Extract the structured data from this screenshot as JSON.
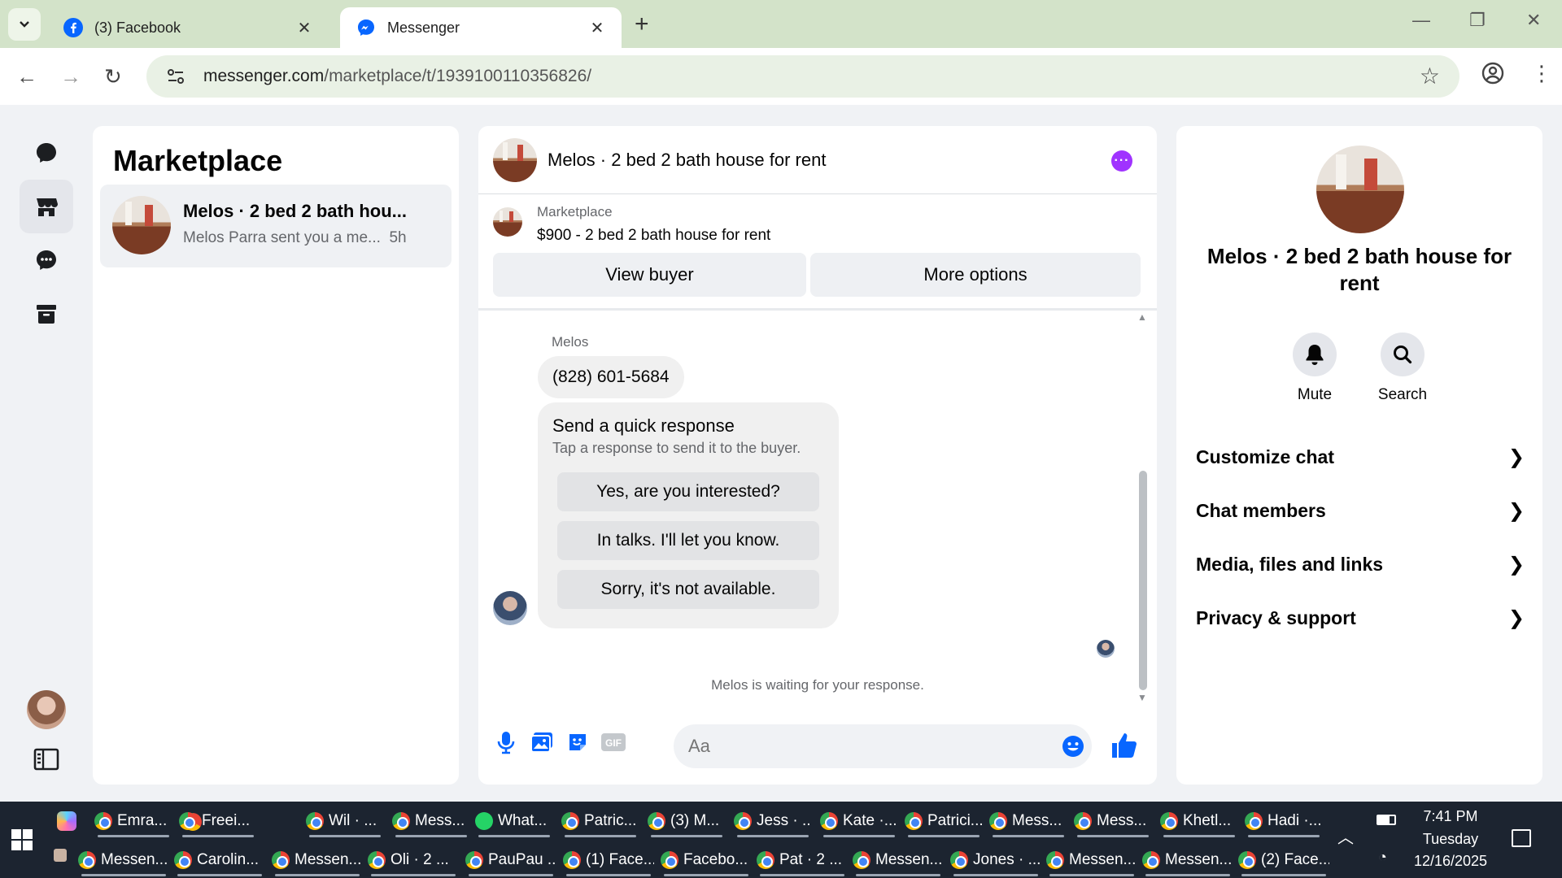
{
  "browser": {
    "tabs": [
      {
        "title": "(3) Facebook"
      },
      {
        "title": "Messenger"
      }
    ],
    "url_host": "messenger.com",
    "url_path": "/marketplace/t/1939100110356826/"
  },
  "left_panel": {
    "title": "Marketplace",
    "conversation": {
      "name": "Melos · 2 bed 2 bath hou...",
      "preview": "Melos Parra sent you a me...",
      "time": "5h"
    }
  },
  "chat": {
    "header_title": "Melos · 2 bed 2 bath house for rent",
    "listing_category": "Marketplace",
    "listing_title": "$900 - 2 bed 2 bath house for rent",
    "view_buyer_label": "View buyer",
    "more_options_label": "More options",
    "sender": "Melos",
    "phone_message": "(828) 601-5684",
    "quick_title": "Send a quick response",
    "quick_subtitle": "Tap a response to send it to the buyer.",
    "quick_responses": [
      "Yes, are you interested?",
      "In talks. I'll let you know.",
      "Sorry, it's not available."
    ],
    "waiting_text": "Melos is waiting for your response.",
    "composer_placeholder": "Aa",
    "gif_label": "GIF"
  },
  "info": {
    "title": "Melos · 2 bed 2 bath house for rent",
    "mute_label": "Mute",
    "search_label": "Search",
    "rows": [
      "Customize chat",
      "Chat members",
      "Media, files and links",
      "Privacy & support"
    ]
  },
  "taskbar": {
    "row1": [
      "Emra...",
      "Freei...",
      "Wil · ...",
      "Mess...",
      "What...",
      "Patric...",
      "(3) M...",
      "Jess · ...",
      "Kate ·...",
      "Patrici...",
      "Mess...",
      "Mess...",
      "Khetl...",
      "Hadi ·..."
    ],
    "row2": [
      "Messen...",
      "Carolin...",
      "Messen...",
      "Oli · 2 ...",
      "PauPau ...",
      "(1) Face...",
      "Facebo...",
      "Pat · 2 ...",
      "Messen...",
      "Jones · ...",
      "Messen...",
      "Messen...",
      "(2) Face..."
    ],
    "time": "7:41 PM",
    "day": "Tuesday",
    "date": "12/16/2025"
  },
  "colors": {
    "accent": "#0866ff",
    "more_purple": "#a033ff",
    "tabbar": "#d3e3c9"
  }
}
